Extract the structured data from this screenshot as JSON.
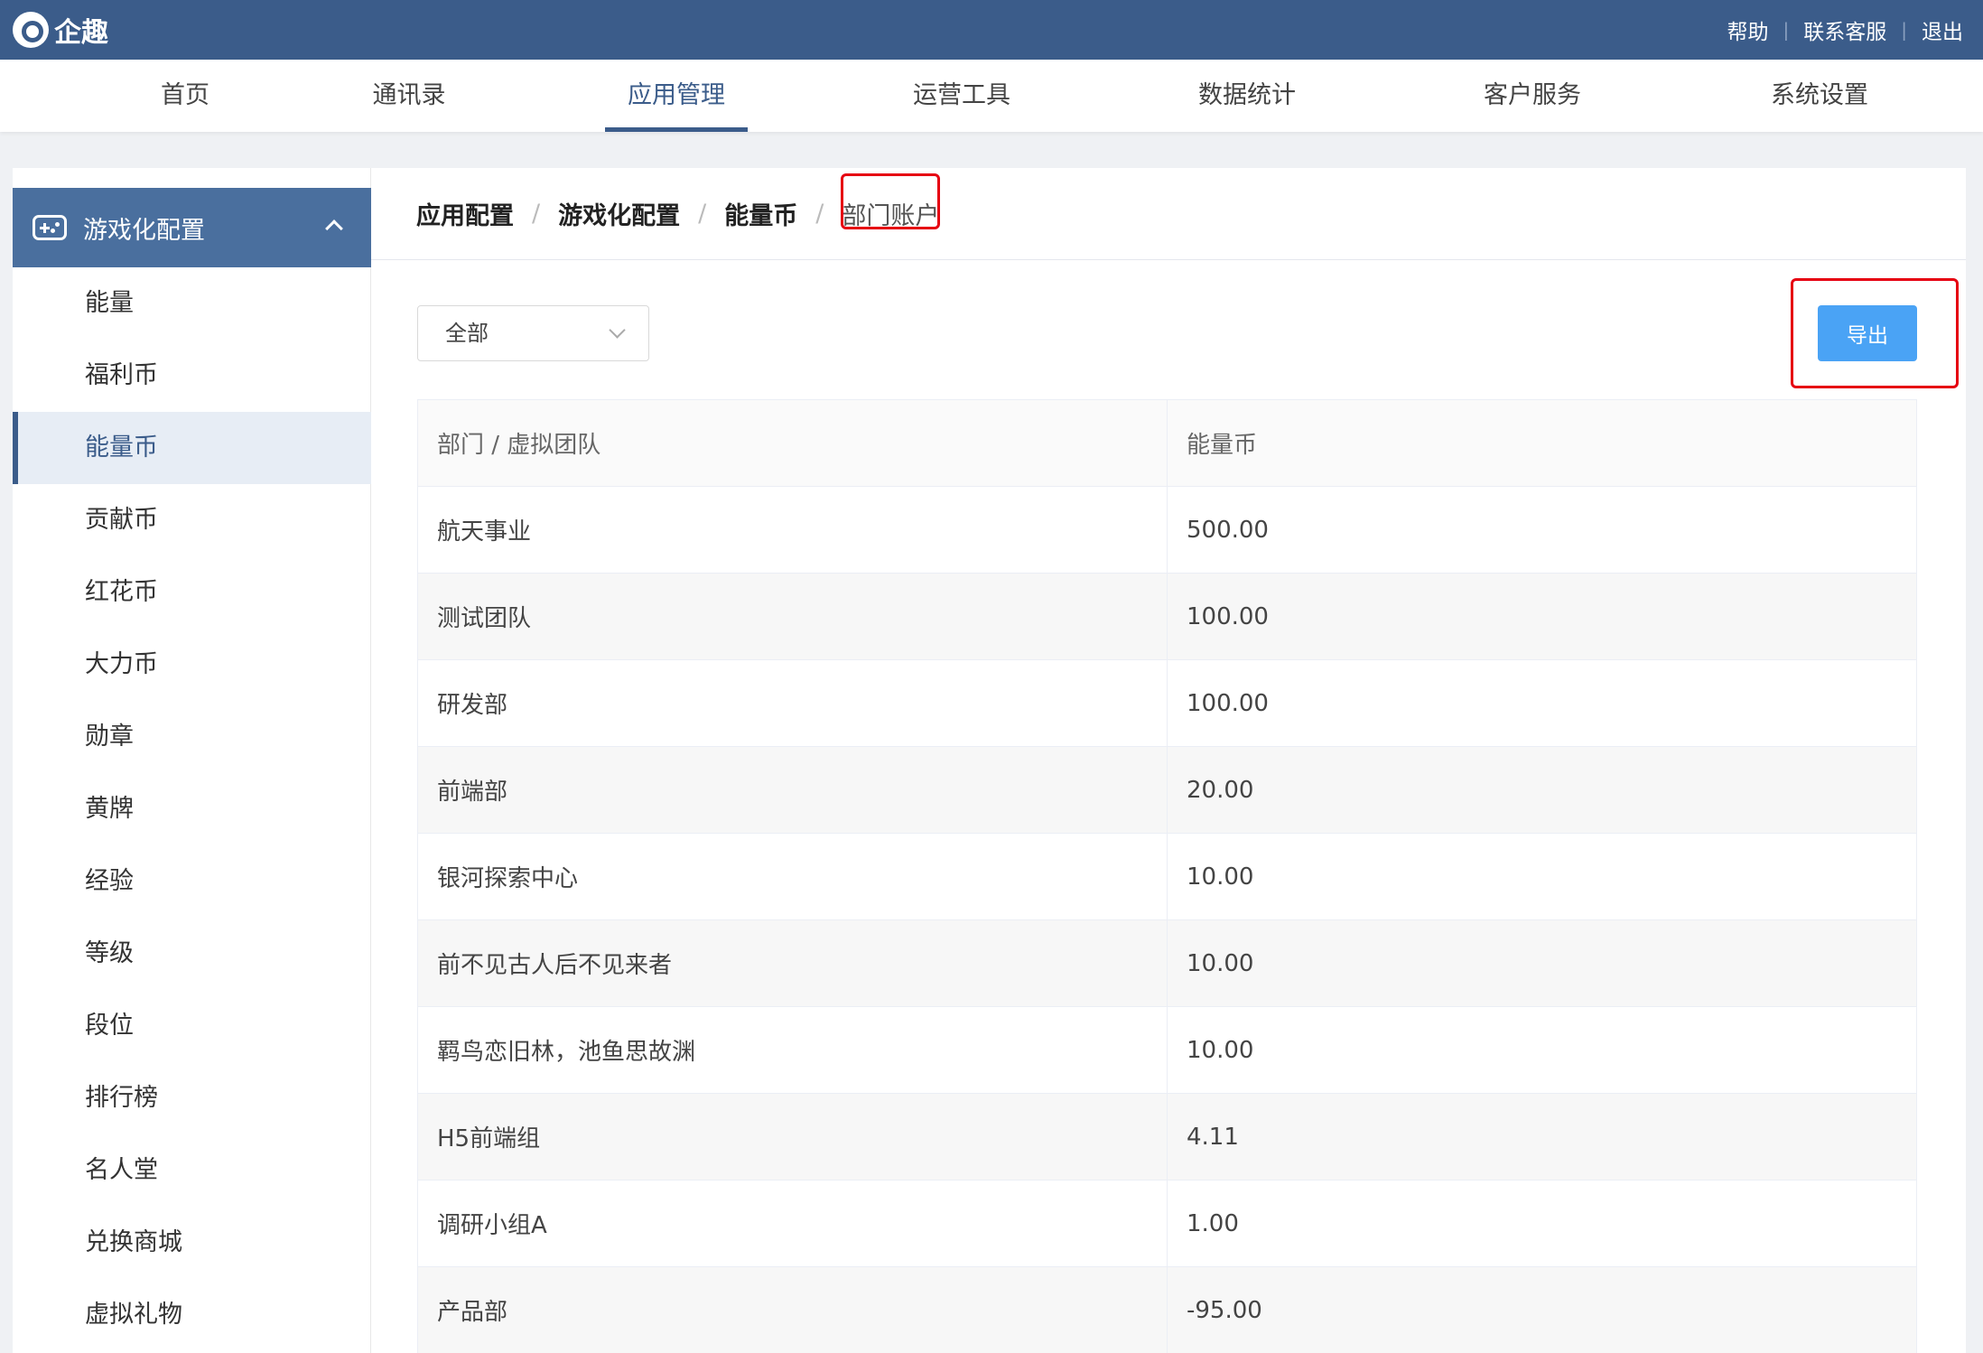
{
  "header": {
    "logo_text": "企趣",
    "links": [
      "帮助",
      "联系客服",
      "退出"
    ]
  },
  "nav": {
    "items": [
      "首页",
      "通讯录",
      "应用管理",
      "运营工具",
      "数据统计",
      "客户服务",
      "系统设置"
    ],
    "active": "应用管理"
  },
  "sidebar": {
    "section_title": "游戏化配置",
    "items": [
      "能量",
      "福利币",
      "能量币",
      "贡献币",
      "红花币",
      "大力币",
      "勋章",
      "黄牌",
      "经验",
      "等级",
      "段位",
      "排行榜",
      "名人堂",
      "兑换商城",
      "虚拟礼物"
    ],
    "active": "能量币"
  },
  "breadcrumb": {
    "items": [
      "应用配置",
      "游戏化配置",
      "能量币"
    ],
    "current": "部门账户",
    "separator": "/"
  },
  "filter": {
    "selected": "全部"
  },
  "toolbar": {
    "export_label": "导出"
  },
  "table": {
    "headers": [
      "部门 / 虚拟团队",
      "能量币"
    ],
    "rows": [
      [
        "航天事业",
        "500.00"
      ],
      [
        "测试团队",
        "100.00"
      ],
      [
        "研发部",
        "100.00"
      ],
      [
        "前端部",
        "20.00"
      ],
      [
        "银河探索中心",
        "10.00"
      ],
      [
        "前不见古人后不见来者",
        "10.00"
      ],
      [
        "羁鸟恋旧林，池鱼思故渊",
        "10.00"
      ],
      [
        "H5前端组",
        "4.11"
      ],
      [
        "调研小组A",
        "1.00"
      ],
      [
        "产品部",
        "-95.00"
      ]
    ]
  },
  "colors": {
    "header_bg": "#3b5c8a",
    "sidebar_head_bg": "#4a6f9e",
    "primary_button": "#4aa3f5",
    "highlight_box": "#e60012"
  }
}
